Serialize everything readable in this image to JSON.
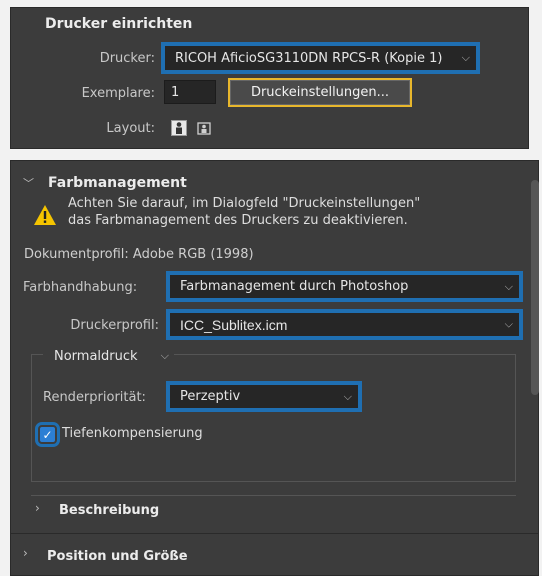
{
  "setup": {
    "title": "Drucker einrichten",
    "printer_label": "Drucker:",
    "printer_value": "RICOH AficioSG3110DN RPCS-R (Kopie 1)",
    "copies_label": "Exemplare:",
    "copies_value": "1",
    "print_settings_button": "Druckeinstellungen...",
    "layout_label": "Layout:"
  },
  "color": {
    "title": "Farbmanagement",
    "warning_line1": "Achten Sie darauf, im Dialogfeld \"Druckeinstellungen\"",
    "warning_line2": "das Farbmanagement des Druckers zu deaktivieren.",
    "doc_profile": "Dokumentprofil: Adobe RGB (1998)",
    "handling_label": "Farbhandhabung:",
    "handling_value": "Farbmanagement durch Photoshop",
    "printer_profile_label": "Druckerprofil:",
    "printer_profile_value": "ICC_Sublitex.icm",
    "print_mode": "Normaldruck",
    "render_label": "Renderpriorität:",
    "render_value": "Perzeptiv",
    "depth_comp_label": "Tiefenkompensierung"
  },
  "sections": {
    "description": "Beschreibung",
    "position_size": "Position und Größe"
  },
  "colors": {
    "highlight_blue": "#1f6fb2",
    "highlight_yellow": "#e8b72c",
    "panel_bg": "#3c3c3c"
  },
  "icons": [
    "portrait-layout-icon",
    "landscape-layout-icon",
    "warning-icon",
    "chevron-down-icon",
    "disclosure-arrow-icon",
    "checkmark-icon"
  ]
}
